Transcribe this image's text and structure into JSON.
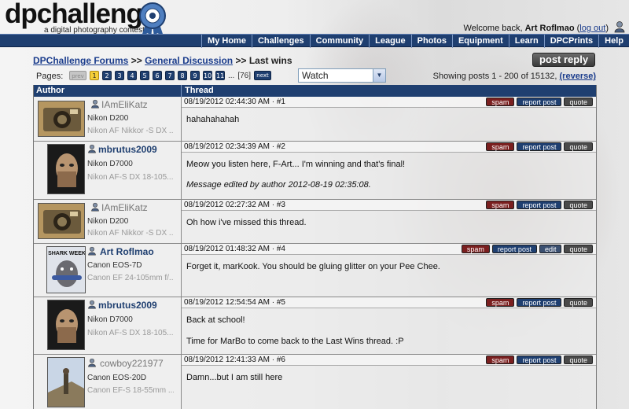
{
  "header": {
    "logo_text": "dpchallenge",
    "logo_sub": "a digital photography contest",
    "welcome_prefix": "Welcome back,",
    "user": "Art Roflmao",
    "logout": "log out"
  },
  "nav": [
    "My Home",
    "Challenges",
    "Community",
    "League",
    "Photos",
    "Equipment",
    "Learn",
    "DPCPrints",
    "Help"
  ],
  "breadcrumb": {
    "forums": "DPChallenge Forums",
    "sep": ">>",
    "general": "General Discussion",
    "current": "Last wins"
  },
  "post_reply": "post reply",
  "pagination": {
    "label": "Pages:",
    "prev": "prev",
    "pages": [
      "1",
      "2",
      "3",
      "4",
      "5",
      "6",
      "7",
      "8",
      "9",
      "10",
      "11"
    ],
    "current": "1",
    "dots": "...",
    "last": "[76]",
    "next": "next"
  },
  "watch": {
    "selected": "Watch"
  },
  "showing": {
    "text": "Showing posts 1 - 200 of 15132,",
    "reverse": "(reverse)"
  },
  "table": {
    "author_header": "Author",
    "thread_header": "Thread"
  },
  "buttons": {
    "spam": "spam",
    "report": "report post",
    "quote": "quote",
    "edit": "edit"
  },
  "posts": [
    {
      "author": "IAmEliKatz",
      "camera": "Nikon D200",
      "lens": "Nikon AF Nikkor -S DX ...",
      "meta": "08/19/2012 02:44:30 AM · #1",
      "body": "hahahahahah",
      "edited": "",
      "body2": ""
    },
    {
      "author": "mbrutus2009",
      "camera": "Nikon D7000",
      "lens": "Nikon AF-S DX 18-105...",
      "meta": "08/19/2012 02:34:39 AM · #2",
      "body": "Meow you listen here, F-Art... I'm winning and that's final!",
      "edited": "Message edited by author 2012-08-19 02:35:08.",
      "body2": ""
    },
    {
      "author": "IAmEliKatz",
      "camera": "Nikon D200",
      "lens": "Nikon AF Nikkor -S DX ...",
      "meta": "08/19/2012 02:27:32 AM · #3",
      "body": "Oh how i've missed this thread.",
      "edited": "",
      "body2": ""
    },
    {
      "author": "Art Roflmao",
      "camera": "Canon EOS-7D",
      "lens": "Canon EF 24-105mm f/...",
      "meta": "08/19/2012 01:48:32 AM · #4",
      "body": "Forget it, marKook. You should be gluing glitter on your Pee Chee.",
      "edited": "",
      "body2": "",
      "avatar_text": "SHARK WEEK"
    },
    {
      "author": "mbrutus2009",
      "camera": "Nikon D7000",
      "lens": "Nikon AF-S DX 18-105...",
      "meta": "08/19/2012 12:54:54 AM · #5",
      "body": "Back at school!",
      "edited": "",
      "body2": "Time for MarBo to come back to the Last Wins thread. :P"
    },
    {
      "author": "cowboy221977",
      "camera": "Canon EOS-20D",
      "lens": "Canon EF-S 18-55mm ...",
      "meta": "08/19/2012 12:41:33 AM · #6",
      "body": "Damn...but I am still here",
      "edited": "",
      "body2": ""
    }
  ]
}
